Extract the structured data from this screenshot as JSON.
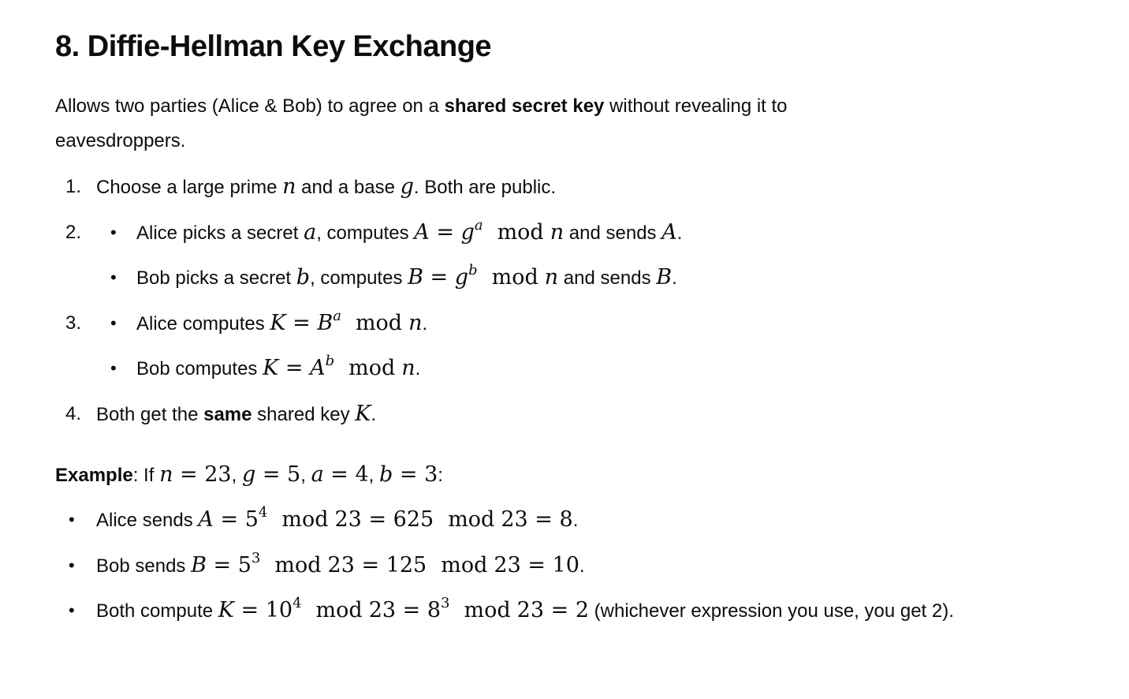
{
  "heading": "8. Diffie-Hellman Key Exchange",
  "intro": {
    "before": "Allows two parties (Alice & Bob) to agree on a ",
    "bold": "shared secret key",
    "after": " without revealing it to eavesdroppers."
  },
  "steps": {
    "s1": {
      "num": "1.",
      "t1": "Choose a large prime ",
      "v_n": "n",
      "t2": " and a base ",
      "v_g": "g",
      "t3": ". Both are public."
    },
    "s2": {
      "num": "2.",
      "alice": {
        "t1": "Alice picks a secret ",
        "v_a": "a",
        "t2": ", computes ",
        "lhs": "A",
        "eq": " = ",
        "base": "g",
        "exp": "a",
        "mod": "mod",
        "n": "n",
        "t3": " and sends ",
        "send": "A",
        "end": "."
      },
      "bob": {
        "t1": "Bob picks a secret ",
        "v_b": "b",
        "t2": ", computes ",
        "lhs": "B",
        "eq": " = ",
        "base": "g",
        "exp": "b",
        "mod": "mod",
        "n": "n",
        "t3": " and sends ",
        "send": "B",
        "end": "."
      }
    },
    "s3": {
      "num": "3.",
      "alice": {
        "t1": "Alice computes ",
        "lhs": "K",
        "eq": " = ",
        "base": "B",
        "exp": "a",
        "mod": "mod",
        "n": "n",
        "end": "."
      },
      "bob": {
        "t1": "Bob computes ",
        "lhs": "K",
        "eq": " = ",
        "base": "A",
        "exp": "b",
        "mod": "mod",
        "n": "n",
        "end": "."
      }
    },
    "s4": {
      "num": "4.",
      "t1": "Both get the ",
      "bold": "same",
      "t2": " shared key ",
      "v_k": "K",
      "end": "."
    }
  },
  "example": {
    "label": "Example",
    "intro": ": If ",
    "vars": {
      "n": "n",
      "eq": " = ",
      "nv": "23",
      "c1": ", ",
      "g": "g",
      "gv": "5",
      "c2": ", ",
      "a": "a",
      "av": "4",
      "c3": ", ",
      "b": "b",
      "bv": "3",
      "end": ":"
    },
    "b1": {
      "t1": "Alice sends ",
      "lhs": "A",
      "eq": " = ",
      "base": "5",
      "exp": "4",
      "mod": "mod",
      "m1": "23",
      "eq2": " = ",
      "mid": "625",
      "mod2": "mod",
      "m2": "23",
      "eq3": " = ",
      "res": "8",
      "end": "."
    },
    "b2": {
      "t1": "Bob sends ",
      "lhs": "B",
      "eq": " = ",
      "base": "5",
      "exp": "3",
      "mod": "mod",
      "m1": "23",
      "eq2": " = ",
      "mid": "125",
      "mod2": "mod",
      "m2": "23",
      "eq3": " = ",
      "res": "10",
      "end": "."
    },
    "b3": {
      "t1": "Both compute ",
      "lhs": "K",
      "eq": " = ",
      "base1": "10",
      "exp1": "4",
      "mod": "mod",
      "m1": "23",
      "eq2": " = ",
      "base2": "8",
      "exp2": "3",
      "mod2": "mod",
      "m2": "23",
      "eq3": " = ",
      "res": "2",
      "tail": " (whichever expression you use, you get 2)."
    }
  },
  "bullet": "•"
}
